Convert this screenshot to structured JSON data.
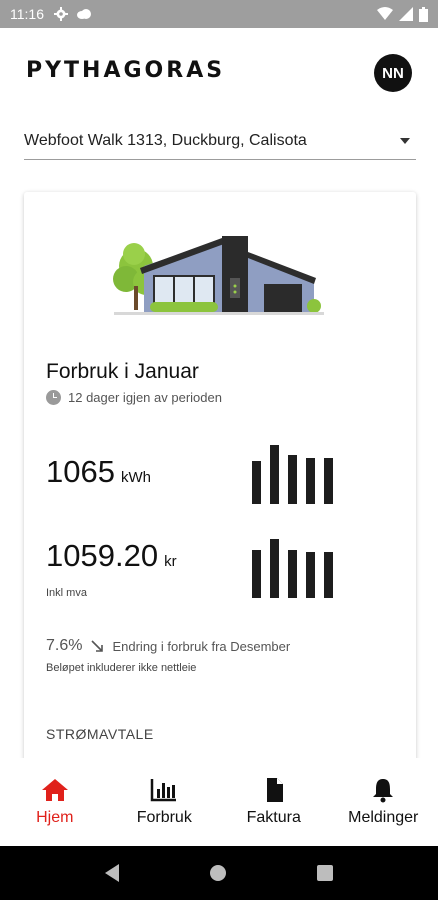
{
  "status_bar": {
    "time": "11:16",
    "icons": [
      "gear-icon",
      "cloud-icon",
      "wifi-icon",
      "signal-icon",
      "battery-icon"
    ]
  },
  "header": {
    "logo": "PYTHAGORAS",
    "avatar_initials": "NN"
  },
  "address": {
    "selected": "Webfoot Walk 1313, Duckburg, Calisota"
  },
  "usage_card": {
    "title": "Forbruk i Januar",
    "period_remaining": "12 dager igjen av perioden",
    "consumption": {
      "value": "1065",
      "unit": "kWh",
      "bars": [
        0.72,
        0.98,
        0.82,
        0.76,
        0.76
      ]
    },
    "cost": {
      "value": "1059.20",
      "unit": "kr",
      "note": "Inkl mva",
      "bars": [
        0.8,
        0.98,
        0.8,
        0.76,
        0.76
      ]
    },
    "change": {
      "percent": "7.6%",
      "description": "Endring i forbruk fra Desember"
    },
    "disclaimer": "Beløpet inkluderer ikke nettleie",
    "section_label": "STRØMAVTALE"
  },
  "bottom_nav": {
    "items": [
      {
        "label": "Hjem",
        "icon": "home-icon",
        "active": true
      },
      {
        "label": "Forbruk",
        "icon": "bar-chart-icon",
        "active": false
      },
      {
        "label": "Faktura",
        "icon": "document-icon",
        "active": false
      },
      {
        "label": "Meldinger",
        "icon": "bell-icon",
        "active": false
      }
    ]
  },
  "colors": {
    "accent": "#e0211b",
    "status_bar": "#9e9e9e",
    "bar": "#1d1d1d"
  }
}
